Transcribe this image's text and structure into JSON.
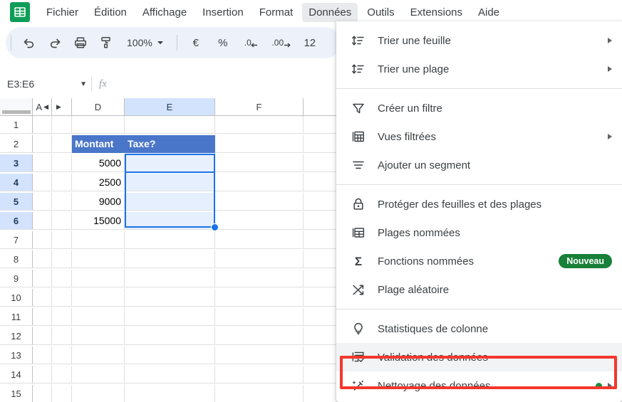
{
  "app": {
    "logo_icon": "sheets-logo-icon"
  },
  "menubar": {
    "items": [
      {
        "label": "Fichier",
        "active": false
      },
      {
        "label": "Édition",
        "active": false
      },
      {
        "label": "Affichage",
        "active": false
      },
      {
        "label": "Insertion",
        "active": false
      },
      {
        "label": "Format",
        "active": false
      },
      {
        "label": "Données",
        "active": true
      },
      {
        "label": "Outils",
        "active": false
      },
      {
        "label": "Extensions",
        "active": false
      },
      {
        "label": "Aide",
        "active": false
      }
    ]
  },
  "toolbar": {
    "undo_icon": "undo-icon",
    "redo_icon": "redo-icon",
    "print_icon": "print-icon",
    "paint_format_icon": "paint-format-icon",
    "zoom_value": "100%",
    "currency_label": "€",
    "percent_label": "%",
    "decrease_decimal_label": ".0",
    "increase_decimal_label": ".00",
    "more_formats_label": "12"
  },
  "formula_bar": {
    "name_box_value": "E3:E6",
    "fx_label": "fx",
    "formula_value": "",
    "formula_placeholder": ""
  },
  "grid": {
    "columns": [
      {
        "label": "A",
        "selected": false,
        "collapsed": true
      },
      {
        "label": "",
        "selected": false,
        "expander": true
      },
      {
        "label": "D",
        "selected": false
      },
      {
        "label": "E",
        "selected": true
      },
      {
        "label": "F",
        "selected": false
      },
      {
        "label": "",
        "selected": false
      }
    ],
    "rows": [
      {
        "num": "1",
        "selected": false
      },
      {
        "num": "2",
        "selected": false
      },
      {
        "num": "3",
        "selected": true
      },
      {
        "num": "4",
        "selected": true
      },
      {
        "num": "5",
        "selected": true
      },
      {
        "num": "6",
        "selected": true
      },
      {
        "num": "7",
        "selected": false
      },
      {
        "num": "8",
        "selected": false
      },
      {
        "num": "9",
        "selected": false
      },
      {
        "num": "10",
        "selected": false
      },
      {
        "num": "11",
        "selected": false
      },
      {
        "num": "12",
        "selected": false
      },
      {
        "num": "13",
        "selected": false
      },
      {
        "num": "14",
        "selected": false
      },
      {
        "num": "15",
        "selected": false
      }
    ],
    "cells": {
      "d2": "Montant",
      "e2": "Taxe?",
      "d3": "5000",
      "d4": "2500",
      "d5": "9000",
      "d6": "15000",
      "e3": "",
      "e4": "",
      "e5": "",
      "e6": ""
    },
    "selection_range": "E3:E6",
    "header_fill_color": "#4a76c9",
    "selection_color": "#1a73e8"
  },
  "dropdown": {
    "title": "Données",
    "items": [
      {
        "id": "trier-une-feuille",
        "label": "Trier une feuille",
        "icon": "sort-icon",
        "submenu": true
      },
      {
        "id": "trier-une-plage",
        "label": "Trier une plage",
        "icon": "sort-icon",
        "submenu": true
      },
      {
        "id": "sep-1",
        "separator": true
      },
      {
        "id": "creer-un-filtre",
        "label": "Créer un filtre",
        "icon": "filter-icon",
        "submenu": false
      },
      {
        "id": "vues-filtrees",
        "label": "Vues filtrées",
        "icon": "filter-views-icon",
        "submenu": true
      },
      {
        "id": "ajouter-un-segment",
        "label": "Ajouter un segment",
        "icon": "slicer-icon",
        "submenu": false
      },
      {
        "id": "sep-2",
        "separator": true
      },
      {
        "id": "proteger-des-feuilles-et-des-plages",
        "label": "Protéger des feuilles et des plages",
        "icon": "lock-icon",
        "submenu": false
      },
      {
        "id": "plages-nommees",
        "label": "Plages nommées",
        "icon": "named-ranges-icon",
        "submenu": false
      },
      {
        "id": "fonctions-nommees",
        "label": "Fonctions nommées",
        "icon": "sigma-icon",
        "submenu": false,
        "badge": "Nouveau"
      },
      {
        "id": "plage-aleatoire",
        "label": "Plage aléatoire",
        "icon": "shuffle-icon",
        "submenu": false
      },
      {
        "id": "sep-3",
        "separator": true
      },
      {
        "id": "statistiques-de-colonne",
        "label": "Statistiques de colonne",
        "icon": "lightbulb-icon",
        "submenu": false
      },
      {
        "id": "validation-des-donnees",
        "label": "Validation des données",
        "icon": "data-validation-icon",
        "submenu": false,
        "highlighted": true
      },
      {
        "id": "nettoyage-des-donnees",
        "label": "Nettoyage des données",
        "icon": "data-cleanup-icon",
        "submenu": true,
        "dot": true
      }
    ],
    "badge_color": "#188038",
    "highlight_box_color": "#f4372c"
  }
}
